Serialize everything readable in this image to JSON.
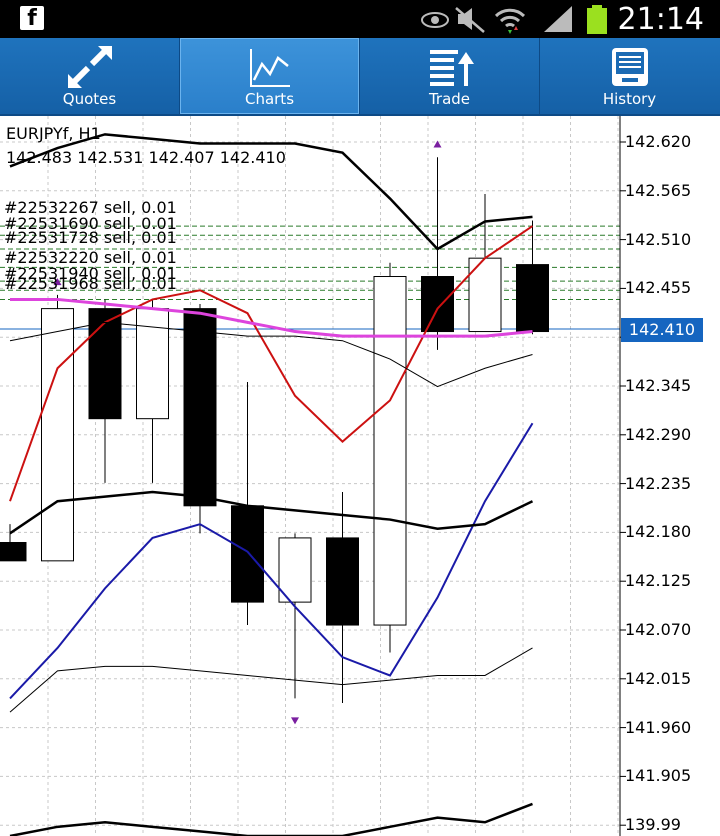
{
  "status_bar": {
    "time": "21:14",
    "icons": [
      "facebook-icon",
      "eye-icon",
      "mute-icon",
      "wifi-icon",
      "signal-icon",
      "battery-icon"
    ],
    "fb_glyph": "f"
  },
  "tabs": [
    {
      "label": "Quotes",
      "icon": "quotes-arrows-icon",
      "active": false
    },
    {
      "label": "Charts",
      "icon": "chart-line-icon",
      "active": true
    },
    {
      "label": "Trade",
      "icon": "trade-list-icon",
      "active": false
    },
    {
      "label": "History",
      "icon": "history-document-icon",
      "active": false
    }
  ],
  "chart": {
    "symbol_label": "EURJPYf, H1",
    "ohlc_label": "142.483 142.531 142.407 142.410",
    "current_price": "142.410",
    "price_labels": [
      "142.620",
      "142.565",
      "142.510",
      "142.455",
      "142.400",
      "142.345",
      "142.290",
      "142.235",
      "142.180",
      "142.125",
      "142.070",
      "142.015",
      "141.960",
      "141.905",
      "139.99"
    ],
    "orders": [
      "#22532267 sell, 0.01",
      "#22531690 sell, 0.01",
      "#22531728 sell, 0.01",
      "#22532220 sell, 0.01",
      "#22531940 sell, 0.01",
      "#22531968 sell, 0.01"
    ],
    "colors": {
      "red_ma": "#cc1111",
      "blue_ma": "#1a1aa8",
      "magenta_ma": "#dd44dd",
      "order_lines": "#2a7a2a",
      "grid": "#c8c8c8",
      "bid_line": "#1565c0"
    }
  },
  "chart_data": {
    "type": "candlestick",
    "timeframe": "H1",
    "ylim": [
      141.86,
      142.645
    ],
    "candles": [
      {
        "open": 142.18,
        "close": 142.16,
        "high": 142.2,
        "low": 142.16
      },
      {
        "open": 142.16,
        "close": 142.435,
        "high": 142.45,
        "low": 142.16
      },
      {
        "open": 142.435,
        "close": 142.315,
        "high": 142.445,
        "low": 142.245
      },
      {
        "open": 142.315,
        "close": 142.435,
        "high": 142.445,
        "low": 142.245
      },
      {
        "open": 142.435,
        "close": 142.22,
        "high": 142.44,
        "low": 142.19
      },
      {
        "open": 142.22,
        "close": 142.115,
        "high": 142.355,
        "low": 142.09
      },
      {
        "open": 142.115,
        "close": 142.185,
        "high": 142.19,
        "low": 142.01
      },
      {
        "open": 142.185,
        "close": 142.09,
        "high": 142.235,
        "low": 142.005
      },
      {
        "open": 142.09,
        "close": 142.47,
        "high": 142.485,
        "low": 142.06
      },
      {
        "open": 142.47,
        "close": 142.41,
        "high": 142.6,
        "low": 142.39
      },
      {
        "open": 142.41,
        "close": 142.49,
        "high": 142.56,
        "low": 142.41
      },
      {
        "open": 142.483,
        "close": 142.41,
        "high": 142.531,
        "low": 142.407
      }
    ],
    "series": [
      {
        "name": "",
        "color": "#cc1111",
        "values": [
          142.225,
          142.37,
          142.42,
          142.445,
          142.455,
          142.43,
          142.34,
          142.29,
          142.335,
          142.435,
          142.49,
          142.525
        ]
      },
      {
        "name": "",
        "color": "#1a1aa8",
        "values": [
          142.01,
          142.065,
          142.13,
          142.185,
          142.2,
          142.17,
          142.11,
          142.055,
          142.035,
          142.12,
          142.225,
          142.31
        ]
      },
      {
        "name": "",
        "color": "#dd44dd",
        "values": [
          142.445,
          142.445,
          142.44,
          142.435,
          142.43,
          142.42,
          142.41,
          142.405,
          142.405,
          142.405,
          142.405,
          142.41
        ]
      },
      {
        "name": "",
        "color": "#000000",
        "values": [
          142.59,
          142.61,
          142.625,
          142.62,
          142.615,
          142.615,
          142.615,
          142.605,
          142.555,
          142.5,
          142.53,
          142.535
        ]
      },
      {
        "name": "",
        "color": "#000000",
        "values": [
          142.19,
          142.225,
          142.23,
          142.235,
          142.23,
          142.22,
          142.215,
          142.21,
          142.205,
          142.195,
          142.2,
          142.225
        ]
      },
      {
        "name": "",
        "color": "#000000",
        "values": [
          141.86,
          141.87,
          141.875,
          141.87,
          141.865,
          141.86,
          141.86,
          141.86,
          141.87,
          141.88,
          141.875,
          141.895
        ]
      },
      {
        "name": "",
        "color": "#000000",
        "values": [
          142.4,
          142.41,
          142.42,
          142.415,
          142.41,
          142.405,
          142.405,
          142.4,
          142.38,
          142.35,
          142.37,
          142.385
        ]
      },
      {
        "name": "",
        "color": "#000000",
        "values": [
          141.995,
          142.04,
          142.045,
          142.045,
          142.04,
          142.035,
          142.03,
          142.025,
          142.03,
          142.035,
          142.035,
          142.065
        ]
      }
    ],
    "order_levels": [
      142.525,
      142.515,
      142.5,
      142.48,
      142.465,
      142.455,
      142.445
    ],
    "arrows": [
      {
        "candle": 1,
        "price": 142.465,
        "direction": "up"
      },
      {
        "candle": 6,
        "price": 141.985,
        "direction": "down"
      },
      {
        "candle": 9,
        "price": 142.615,
        "direction": "up"
      }
    ]
  }
}
